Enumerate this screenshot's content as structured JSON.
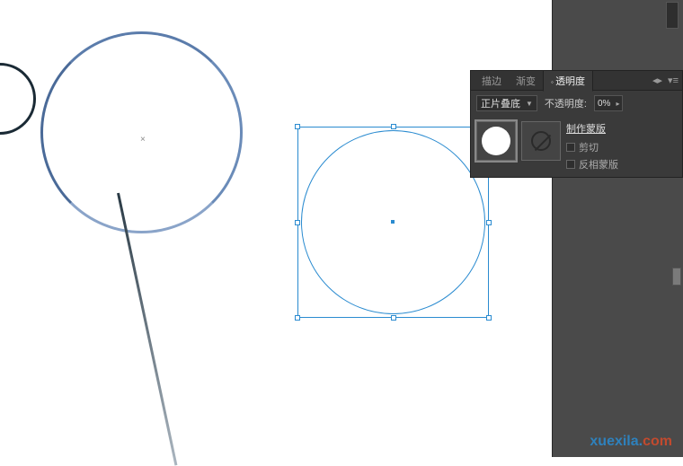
{
  "panel": {
    "tabs": {
      "stroke": "描边",
      "gradient": "渐变",
      "transparency": "透明度"
    },
    "blend_mode": "正片叠底",
    "opacity_label": "不透明度:",
    "opacity_value": "0%",
    "mask": {
      "make": "制作蒙版",
      "clip": "剪切",
      "invert": "反相蒙版"
    }
  },
  "watermark": {
    "a": "xuexila.",
    "b": "com"
  }
}
